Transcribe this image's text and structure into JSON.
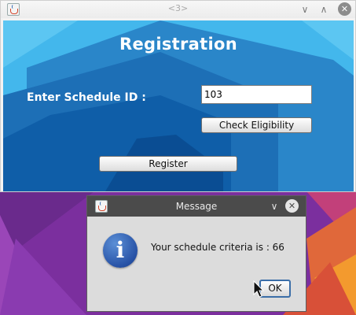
{
  "main_window": {
    "title": "<3>",
    "heading": "Registration",
    "schedule_label": "Enter Schedule ID :",
    "schedule_value": "103",
    "check_button": "Check Eligibility",
    "register_button": "Register",
    "controls": {
      "minimize": "∨",
      "maximize": "∧",
      "close": "✕"
    }
  },
  "dialog": {
    "title": "Message",
    "message": "Your schedule criteria is : 66",
    "ok_button": "OK",
    "icon_glyph": "i",
    "controls": {
      "minimize": "∨",
      "close": "✕"
    }
  },
  "colors": {
    "panel_background": "#43b7ec",
    "dialog_titlebar": "#4b4b4b"
  }
}
